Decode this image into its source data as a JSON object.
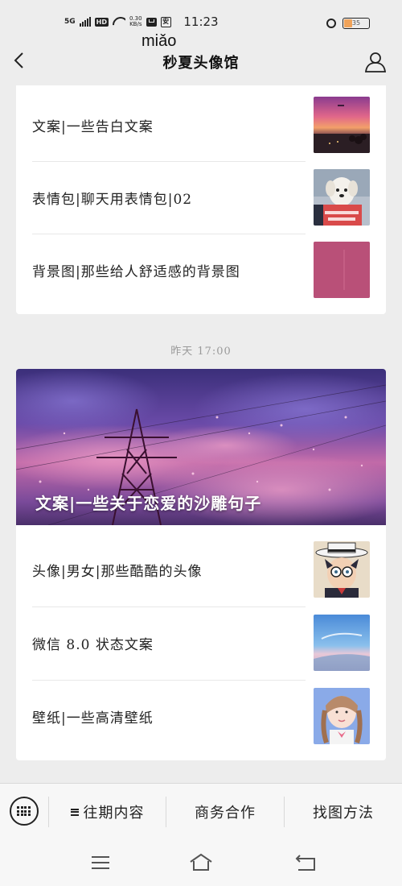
{
  "status_bar": {
    "network": "5G",
    "hd": "HD",
    "speed_value": "0.30",
    "speed_unit": "KB/s",
    "app_glyph": "安",
    "time": "11:23",
    "battery": "35"
  },
  "nav": {
    "pinyin": "miǎo",
    "title": "秒夏头像馆",
    "back_icon": "chevron-left-icon",
    "profile_icon": "user-icon"
  },
  "group1": {
    "articles": [
      {
        "title": "文案|一些告白文案",
        "thumb": "sunset-crowd-photo"
      },
      {
        "title": "表情包|聊天用表情包|02",
        "thumb": "dog-meme-photo"
      },
      {
        "title": "背景图|那些给人舒适感的背景图",
        "thumb": "pink-wall-photo"
      }
    ]
  },
  "date_label": "昨天 17:00",
  "group2": {
    "hero": {
      "title": "文案|一些关于恋爱的沙雕句子",
      "image": "purple-sky-power-tower"
    },
    "articles": [
      {
        "title": "头像|男女|那些酷酷的头像",
        "thumb": "anime-boy-hat-photo"
      },
      {
        "title": "微信 8.0 状态文案",
        "thumb": "blue-sky-beach-photo"
      },
      {
        "title": "壁纸|一些高清壁纸",
        "thumb": "girl-braids-photo"
      }
    ]
  },
  "bottom_menu": {
    "keyboard_icon": "keyboard-icon",
    "items": [
      {
        "label": "往期内容",
        "has_menu_icon": true
      },
      {
        "label": "商务合作"
      },
      {
        "label": "找图方法"
      }
    ]
  },
  "system_nav": {
    "buttons": [
      "menu-icon",
      "home-icon",
      "back-icon"
    ]
  },
  "colors": {
    "background": "#ededed",
    "card": "#ffffff",
    "muted_text": "#9a9a9a",
    "menu_bg": "#f7f7f7"
  }
}
